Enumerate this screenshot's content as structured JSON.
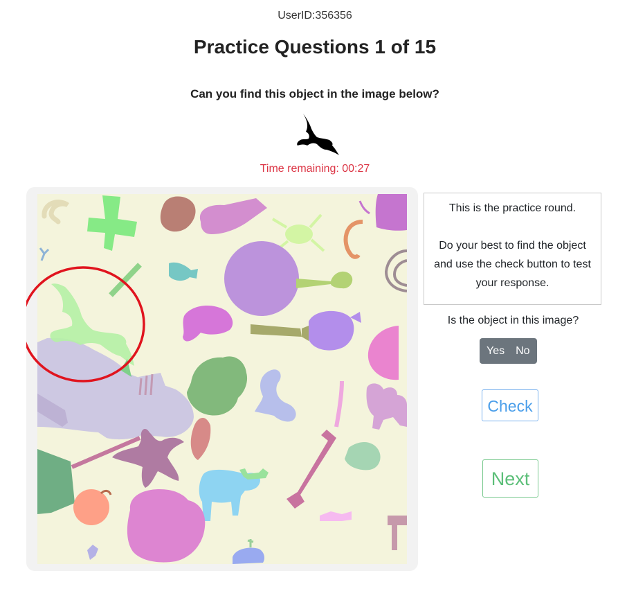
{
  "header": {
    "user_id": "UserID:356356",
    "title": "Practice Questions 1 of 15"
  },
  "prompt": {
    "question": "Can you find this object in the image below?",
    "target_icon": "bat-icon"
  },
  "timer": {
    "text": "Time remaining: 00:27"
  },
  "info": {
    "line1": "This is the practice round.",
    "line2": "Do your best to find the object and use the check button to test your response."
  },
  "answer": {
    "question": "Is the object in this image?",
    "yes_label": "Yes",
    "no_label": "No"
  },
  "buttons": {
    "check_label": "Check",
    "next_label": "Next"
  },
  "colors": {
    "scene_background": "#f4f4dc",
    "timer": "#dc3545",
    "highlight_circle": "#e0141e",
    "check": "#4a9eea",
    "next": "#5cbf79",
    "toggle": "#6c757d"
  }
}
